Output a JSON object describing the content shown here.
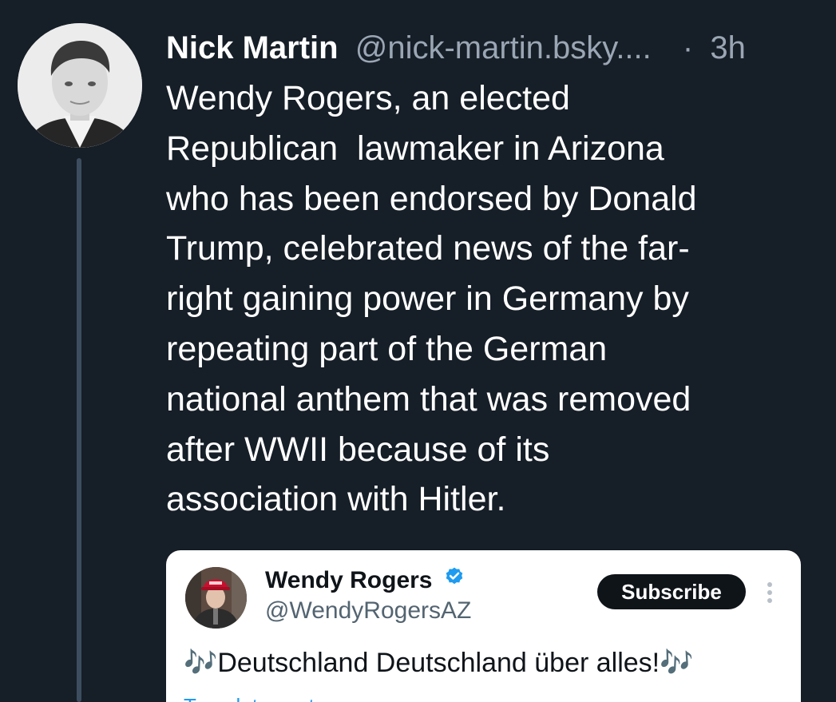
{
  "post": {
    "author_name": "Nick Martin",
    "author_handle": "@nick-martin.bsky....",
    "separator": "·",
    "timestamp": "3h",
    "text_lines": [
      "Wendy Rogers, an elected",
      "Republican  lawmaker in Arizona",
      "who has been endorsed by Donald",
      "Trump, celebrated news of the far-",
      "right gaining power in Germany by",
      "repeating part of the German",
      "national anthem that was removed",
      "after WWII because of its",
      "association with Hitler."
    ]
  },
  "embed": {
    "author_name": "Wendy Rogers",
    "author_handle": "@WendyRogersAZ",
    "subscribe_label": "Subscribe",
    "note_left": "🎶",
    "text": "Deutschland Deutschland über alles!",
    "note_right": "🎶",
    "translate_label": "Translate post"
  },
  "colors": {
    "background": "#161e27",
    "thread_line": "#3d4d60",
    "verified": "#1d9bf0"
  }
}
